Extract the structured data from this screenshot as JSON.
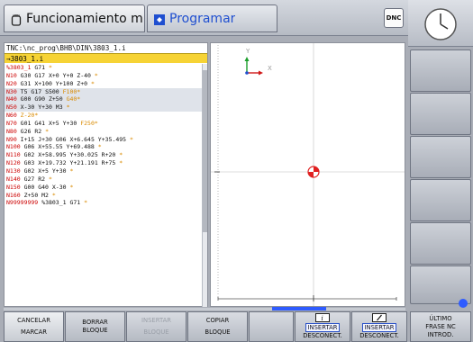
{
  "header": {
    "tab_machine": "Funcionamiento m…",
    "tab_program": "Programar",
    "dnc_badge": "DNC"
  },
  "editor": {
    "path": "TNC:\\nc_prog\\BHB\\DIN\\3803_1.i",
    "current_line": "→3803_1.i",
    "lines": [
      {
        "n": "%3803_1",
        "d": "G71",
        "o": "*"
      },
      {
        "n": "N10",
        "d": "G30 G17 X+0 Y+0 Z-40",
        "o": "*"
      },
      {
        "n": "N20",
        "d": "G31 X+100 Y+100 Z+0",
        "o": "*"
      },
      {
        "n": "N30",
        "d": "T5 G17 S500",
        "o": "F100*"
      },
      {
        "n": "N40",
        "d": "G00 G90 Z+50",
        "o": "G40*"
      },
      {
        "n": "N50",
        "d": "X-30 Y+30 M3",
        "o": "*"
      },
      {
        "n": "N60",
        "d": "",
        "o": "Z-20*"
      },
      {
        "n": "N70",
        "d": "G01 G41 X+5 Y+30",
        "o": "F250*"
      },
      {
        "n": "N80",
        "d": "G26 R2",
        "o": "*"
      },
      {
        "n": "N90",
        "d": "I+15 J+30 G06 X+6.645 Y+35.495",
        "o": "*"
      },
      {
        "n": "N100",
        "d": "G06 X+55.55 Y+69.488",
        "o": "*"
      },
      {
        "n": "N110",
        "d": "G02 X+58.995 Y+30.025 R+20",
        "o": "*"
      },
      {
        "n": "N120",
        "d": "G03 X+19.732 Y+21.191 R+75",
        "o": "*"
      },
      {
        "n": "N130",
        "d": "G02 X+5 Y+30",
        "o": "*"
      },
      {
        "n": "N140",
        "d": "G27 R2",
        "o": "*"
      },
      {
        "n": "N150",
        "d": "G00 G40 X-30",
        "o": "*"
      },
      {
        "n": "N160",
        "d": "Z+50 M2",
        "o": "*"
      },
      {
        "n": "N99999999",
        "d": "%3803_1 G71",
        "o": "*"
      }
    ]
  },
  "graphic": {
    "axis_x": "X",
    "axis_y": "Y"
  },
  "softkeys": {
    "cancel_top": "CANCELAR",
    "cancel_bottom": "MARCAR",
    "delete_top": "BORRAR",
    "delete_bottom": "BLOQUE",
    "insert_top": "INSERTAR",
    "insert_bottom": "BLOQUE",
    "copy_top": "COPIAR",
    "copy_bottom": "BLOQUE",
    "insert_disc1_top": "INSERTAR",
    "insert_disc1_bottom": "DESCONECT.",
    "insert_disc2_top": "INSERTAR",
    "insert_disc2_bottom": "DESCONECT.",
    "last_line1": "ÚLTIMO",
    "last_line2": "FRASE NC",
    "last_line3": "INTROD."
  },
  "colors": {
    "block_number": "#cc0000",
    "highlight_value": "#d98a00",
    "current_line_bg": "#f6d335",
    "program_tab_text": "#1f4fd0"
  }
}
